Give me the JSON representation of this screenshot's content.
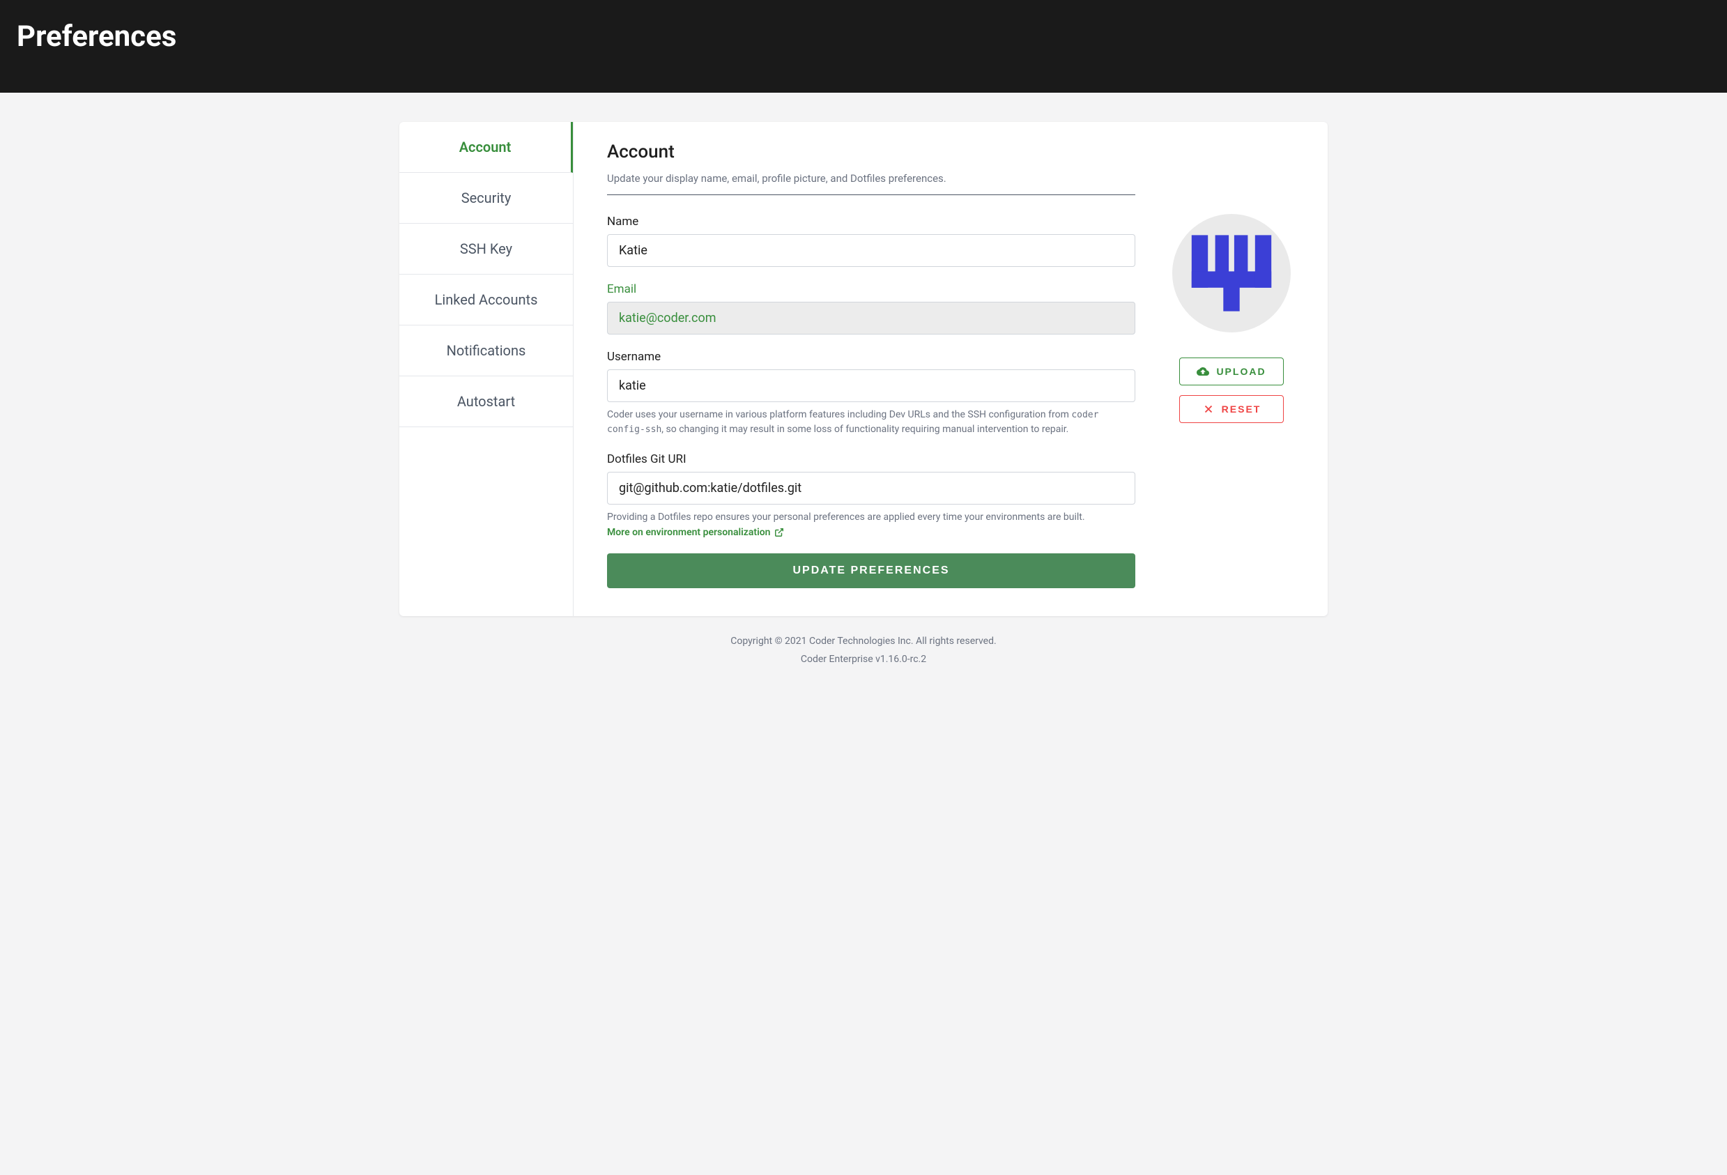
{
  "header": {
    "title": "Preferences"
  },
  "sidebar": {
    "items": [
      {
        "label": "Account",
        "active": true
      },
      {
        "label": "Security",
        "active": false
      },
      {
        "label": "SSH Key",
        "active": false
      },
      {
        "label": "Linked Accounts",
        "active": false
      },
      {
        "label": "Notifications",
        "active": false
      },
      {
        "label": "Autostart",
        "active": false
      }
    ]
  },
  "account": {
    "title": "Account",
    "description": "Update your display name, email, profile picture, and Dotfiles preferences.",
    "name": {
      "label": "Name",
      "value": "Katie"
    },
    "email": {
      "label": "Email",
      "value": "katie@coder.com"
    },
    "username": {
      "label": "Username",
      "value": "katie",
      "help_prefix": "Coder uses your username in various platform features including Dev URLs and the SSH configuration from ",
      "help_code": "coder config-ssh",
      "help_suffix": ", so changing it may result in some loss of functionality requiring manual intervention to repair."
    },
    "dotfiles": {
      "label": "Dotfiles Git URI",
      "value": "git@github.com:katie/dotfiles.git",
      "help": "Providing a Dotfiles repo ensures your personal preferences are applied every time your environments are built.",
      "link_text": "More on environment personalization"
    },
    "submit_label": "Update Preferences"
  },
  "avatar": {
    "upload_label": "UPLOAD",
    "reset_label": "RESET"
  },
  "footer": {
    "copyright": "Copyright © 2021 Coder Technologies Inc. All rights reserved.",
    "version": "Coder Enterprise v1.16.0-rc.2"
  }
}
